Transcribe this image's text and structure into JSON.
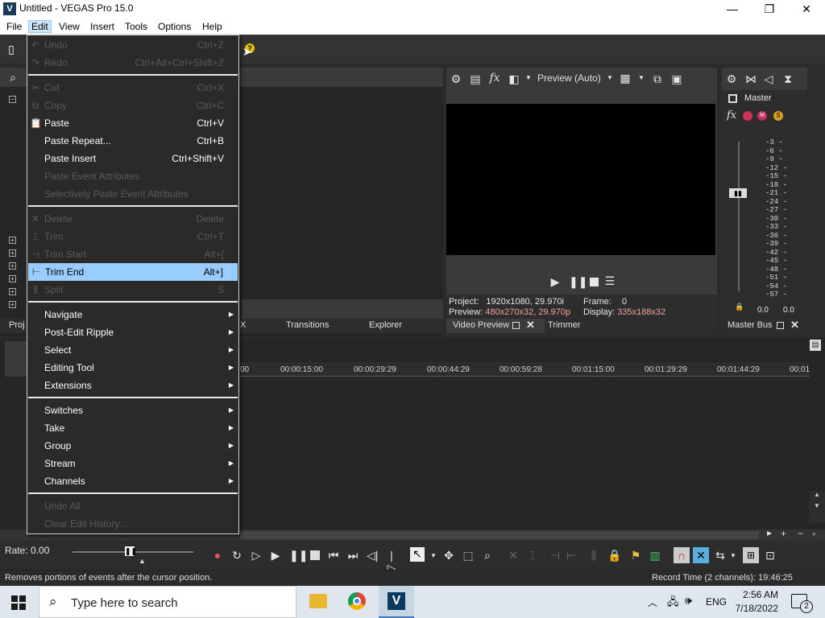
{
  "window": {
    "title": "Untitled - VEGAS Pro 15.0",
    "app_icon": "V",
    "minimize": "—",
    "maximize": "❐",
    "close": "✕"
  },
  "menubar": [
    "File",
    "Edit",
    "View",
    "Insert",
    "Tools",
    "Options",
    "Help"
  ],
  "edit_menu": {
    "group1": [
      {
        "label": "Undo",
        "shortcut": "Ctrl+Z",
        "disabled": true
      },
      {
        "label": "Redo",
        "shortcut": "Ctrl+Alt+Ctrl+Shift+Z",
        "disabled": true
      }
    ],
    "group2": [
      {
        "label": "Cut",
        "shortcut": "Ctrl+X",
        "disabled": true
      },
      {
        "label": "Copy",
        "shortcut": "Ctrl+C",
        "disabled": true
      },
      {
        "label": "Paste",
        "shortcut": "Ctrl+V",
        "disabled": false
      },
      {
        "label": "Paste Repeat...",
        "shortcut": "Ctrl+B",
        "disabled": false
      },
      {
        "label": "Paste Insert",
        "shortcut": "Ctrl+Shift+V",
        "disabled": false
      },
      {
        "label": "Paste Event Attributes",
        "shortcut": "",
        "disabled": true
      },
      {
        "label": "Selectively Paste Event Attributes",
        "shortcut": "",
        "disabled": true
      }
    ],
    "group3": [
      {
        "label": "Delete",
        "shortcut": "Delete",
        "disabled": true
      },
      {
        "label": "Trim",
        "shortcut": "Ctrl+T",
        "disabled": true
      },
      {
        "label": "Trim Start",
        "shortcut": "Alt+[",
        "disabled": true
      },
      {
        "label": "Trim End",
        "shortcut": "Alt+]",
        "disabled": false,
        "highlighted": true
      },
      {
        "label": "Split",
        "shortcut": "S",
        "disabled": true
      }
    ],
    "group4": [
      "Navigate",
      "Post-Edit Ripple",
      "Select",
      "Editing Tool",
      "Extensions"
    ],
    "group5": [
      "Switches",
      "Take",
      "Group",
      "Stream",
      "Channels"
    ],
    "group6": [
      {
        "label": "Undo All",
        "disabled": true
      },
      {
        "label": "Clear Edit History...",
        "disabled": true
      }
    ]
  },
  "preview": {
    "quality": "Preview (Auto)",
    "project_label": "Project:",
    "project_value": "1920x1080, 29.970i",
    "preview_label": "Preview:",
    "preview_value": "480x270x32, 29.970p",
    "frame_label": "Frame:",
    "frame_value": "0",
    "display_label": "Display:",
    "display_value": "335x188x32",
    "tab_video_preview": "Video Preview",
    "tab_trimmer": "Trimmer"
  },
  "left_tabs": {
    "project": "Proj",
    "x": "X",
    "transitions": "Transitions",
    "explorer": "Explorer"
  },
  "mixer": {
    "master_label": "Master",
    "tab": "Master Bus",
    "scale": [
      "3",
      "6",
      "9",
      "12",
      "15",
      "18",
      "21",
      "24",
      "27",
      "30",
      "33",
      "36",
      "39",
      "42",
      "45",
      "48",
      "51",
      "54",
      "57"
    ],
    "left_val": "0.0",
    "right_val": "0.0"
  },
  "timeline": {
    "ticks": [
      "00",
      "00:00:15:00",
      "00:00:29:29",
      "00:00:44:29",
      "00:00:59:28",
      "00:01:15:00",
      "00:01:29:29",
      "00:01:44:29",
      "00:01"
    ],
    "rate": "Rate: 0.00"
  },
  "status": {
    "message": "Removes portions of events after the cursor position.",
    "record_time": "Record Time (2 channels): 19:46:25"
  },
  "taskbar": {
    "search_placeholder": "Type here to search",
    "language": "ENG",
    "time": "2:56 AM",
    "date": "7/18/2022",
    "notifications": "2"
  }
}
